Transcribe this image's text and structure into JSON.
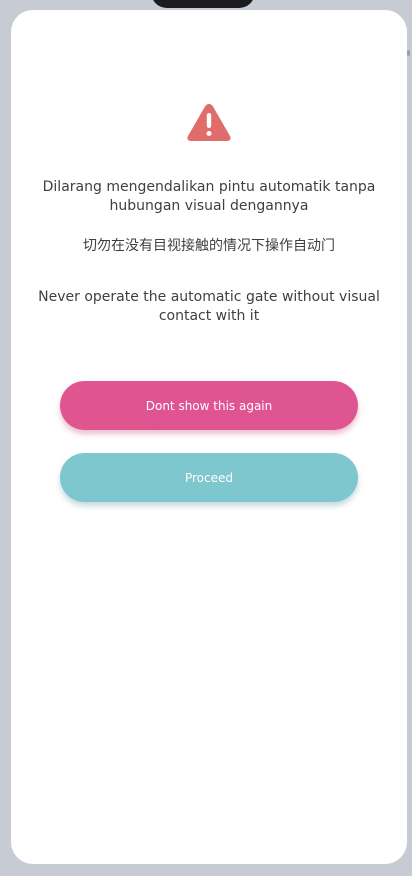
{
  "warning": {
    "icon": "warning-triangle-icon",
    "color": "#e06c6c",
    "message_id": "Dilarang mengendalikan pintu automatik tanpa hubungan visual dengannya",
    "message_zh": "切勿在没有目视接触的情况下操作自动门",
    "message_en": "Never operate the automatic gate without visual contact with it"
  },
  "buttons": {
    "dont_show_label": "Dont show this again",
    "proceed_label": "Proceed"
  },
  "colors": {
    "dont_show": "#e05490",
    "proceed": "#7ec7cf"
  }
}
